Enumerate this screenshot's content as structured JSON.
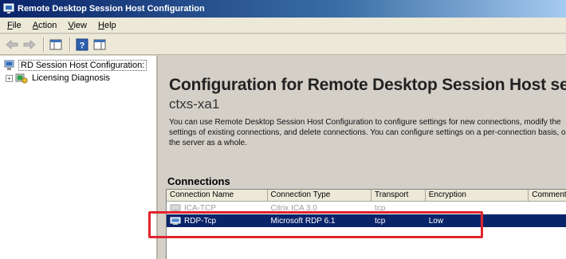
{
  "window": {
    "title": "Remote Desktop Session Host Configuration"
  },
  "menu": [
    {
      "pre": "",
      "u": "F",
      "post": "ile"
    },
    {
      "pre": "",
      "u": "A",
      "post": "ction"
    },
    {
      "pre": "",
      "u": "V",
      "post": "iew"
    },
    {
      "pre": "",
      "u": "H",
      "post": "elp"
    }
  ],
  "tree": {
    "root_label": "RD Session Host Configuration:",
    "child_label": "Licensing Diagnosis",
    "expander_symbol": "+"
  },
  "main": {
    "heading": "Configuration for Remote Desktop Session Host server:",
    "server_name": "ctxs-xa1",
    "description": "You can use Remote Desktop Session Host Configuration to configure settings for new connections, modify the settings of existing connections, and delete connections. You can configure settings on a per-connection basis, or for the server as a whole."
  },
  "connections": {
    "label": "Connections",
    "columns": [
      "Connection Name",
      "Connection Type",
      "Transport",
      "Encryption",
      "Comment"
    ],
    "rows": [
      {
        "name": "ICA-TCP",
        "type": "Citrix ICA 3.0",
        "transport": "tcp",
        "encryption": "",
        "comment": ""
      },
      {
        "name": "RDP-Tcp",
        "type": "Microsoft RDP 6.1",
        "transport": "tcp",
        "encryption": "Low",
        "comment": ""
      }
    ]
  },
  "colors": {
    "title_bar": "#0a246a",
    "selection": "#0a246a",
    "highlight_box": "#e0242c"
  }
}
